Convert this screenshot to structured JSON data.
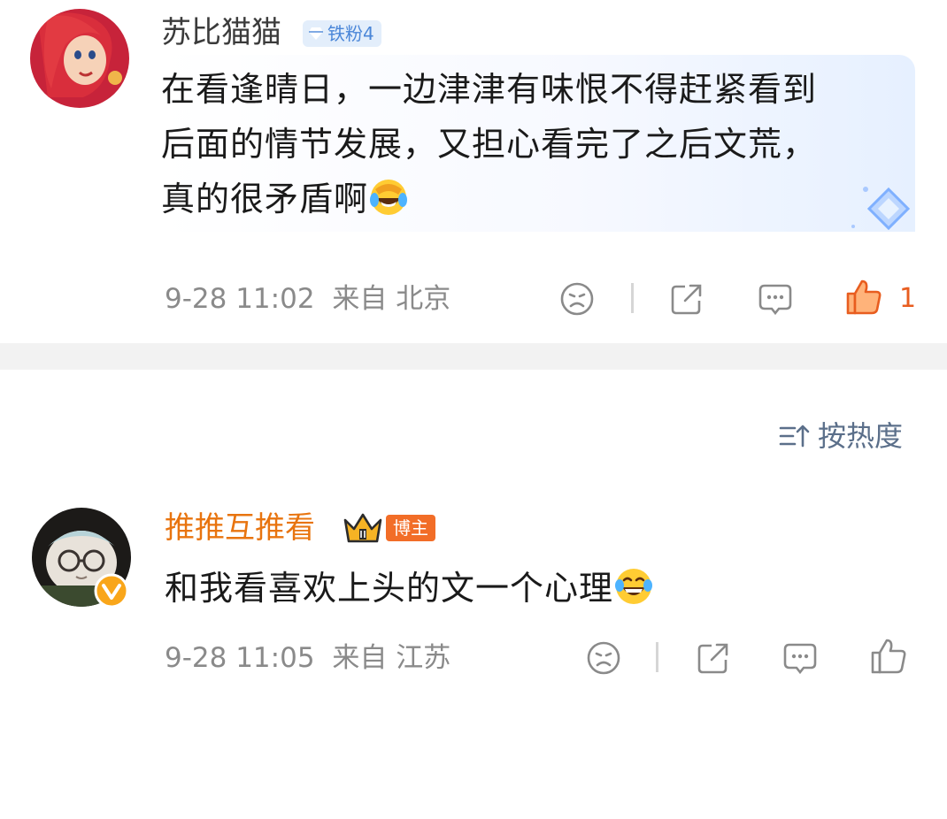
{
  "comment1": {
    "username": "苏比猫猫",
    "fan_badge": "铁粉4",
    "lines": [
      "在看逢晴日，一边津津有味恨不得赶紧看到",
      "后面的情节发展，又担心看完了之后文荒，",
      "真的很矛盾啊"
    ],
    "time": "9-28 11:02",
    "location": "来自 北京",
    "like_count": "1"
  },
  "sort": {
    "label": "按热度"
  },
  "comment2": {
    "username": "推推互推看",
    "role_badge": "博主",
    "text": "和我看喜欢上头的文一个心理",
    "time": "9-28 11:05",
    "location": "来自 江苏"
  },
  "colors": {
    "accent_orange": "#e8740f",
    "like_orange": "#e85d1f",
    "meta_gray": "#8a8a8a",
    "fan_blue": "#4a86d8"
  },
  "icons": [
    "dislike-icon",
    "share-icon",
    "comment-icon",
    "like-icon",
    "sort-icon",
    "verified-icon",
    "crown-icon",
    "laugh-cry-emoji"
  ]
}
